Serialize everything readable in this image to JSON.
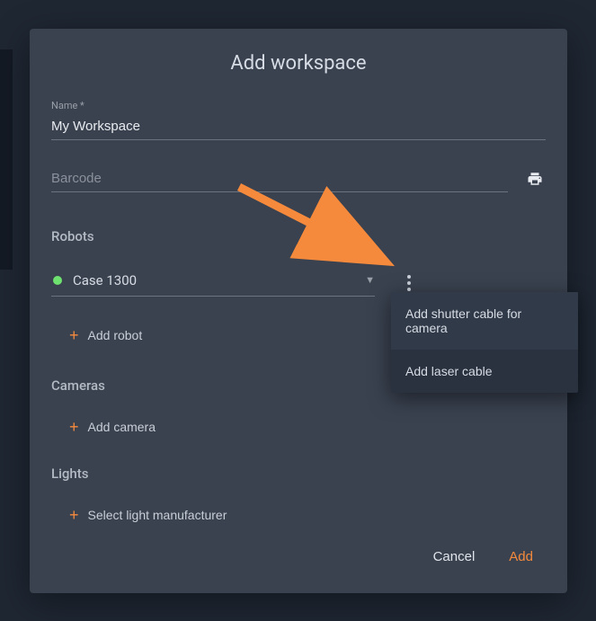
{
  "dialog": {
    "title": "Add workspace",
    "name_label": "Name *",
    "name_value": "My Workspace",
    "barcode_placeholder": "Barcode",
    "barcode_value": ""
  },
  "robots": {
    "title": "Robots",
    "selected": "Case 1300",
    "status_color": "#6ee26e",
    "add_label": "Add robot"
  },
  "cameras": {
    "title": "Cameras",
    "add_label": "Add camera"
  },
  "lights": {
    "title": "Lights",
    "add_label": "Select light manufacturer"
  },
  "popup": {
    "items": [
      "Add shutter cable for camera",
      "Add laser cable"
    ]
  },
  "actions": {
    "cancel": "Cancel",
    "add": "Add"
  },
  "colors": {
    "accent": "#f58a3c",
    "dialog_bg": "#3a4250",
    "popup_bg": "#2a3240"
  }
}
